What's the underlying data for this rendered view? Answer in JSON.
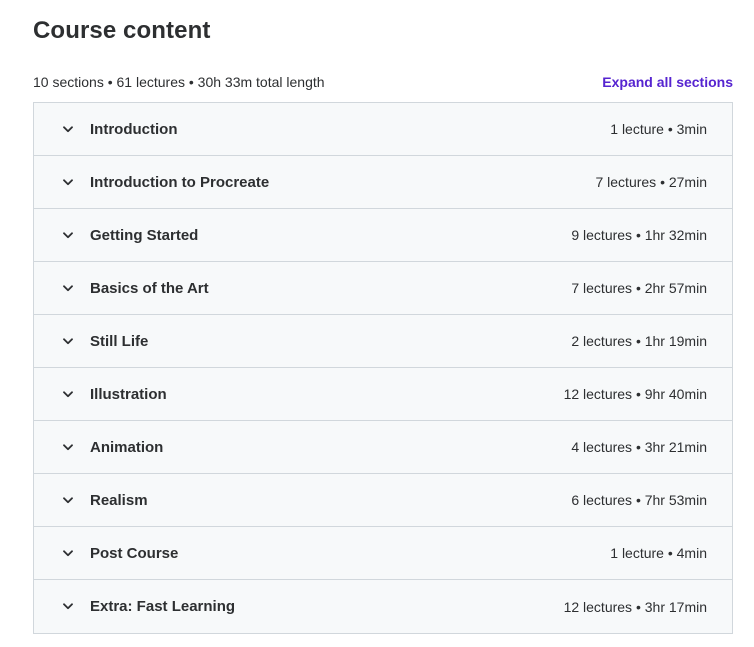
{
  "header": {
    "title": "Course content",
    "summary": "10 sections • 61 lectures • 30h 33m total length",
    "expand_label": "Expand all sections"
  },
  "colors": {
    "accent": "#5624d0",
    "text": "#2d2f31",
    "section_bg": "#f7f9fa",
    "border": "#d1d7dc"
  },
  "sections": [
    {
      "title": "Introduction",
      "meta": "1 lecture • 3min",
      "icon": "chevron-down-icon"
    },
    {
      "title": "Introduction to Procreate",
      "meta": "7 lectures • 27min",
      "icon": "chevron-down-icon"
    },
    {
      "title": "Getting Started",
      "meta": "9 lectures • 1hr 32min",
      "icon": "chevron-down-icon"
    },
    {
      "title": "Basics of the Art",
      "meta": "7 lectures • 2hr 57min",
      "icon": "chevron-down-icon"
    },
    {
      "title": "Still Life",
      "meta": "2 lectures • 1hr 19min",
      "icon": "chevron-down-icon"
    },
    {
      "title": "Illustration",
      "meta": "12 lectures • 9hr 40min",
      "icon": "chevron-down-icon"
    },
    {
      "title": "Animation",
      "meta": "4 lectures • 3hr 21min",
      "icon": "chevron-down-icon"
    },
    {
      "title": "Realism",
      "meta": "6 lectures • 7hr 53min",
      "icon": "chevron-down-icon"
    },
    {
      "title": "Post Course",
      "meta": "1 lecture • 4min",
      "icon": "chevron-down-icon"
    },
    {
      "title": "Extra: Fast Learning",
      "meta": "12 lectures • 3hr 17min",
      "icon": "chevron-down-icon"
    }
  ]
}
